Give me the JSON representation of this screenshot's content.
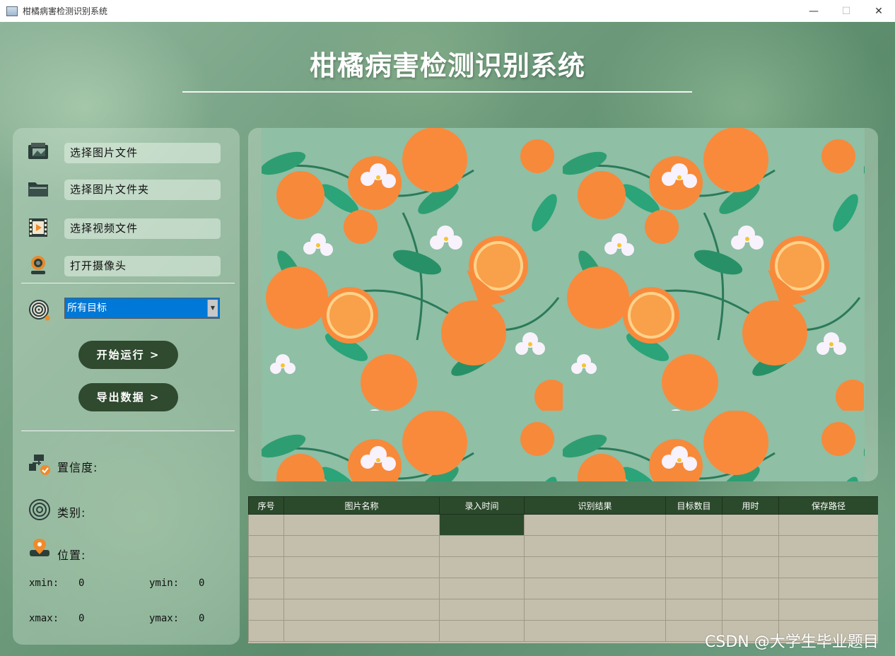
{
  "window": {
    "title": "柑橘病害检测识别系统",
    "minimize_glyph": "—",
    "maximize_glyph": "☐",
    "close_glyph": "✕"
  },
  "header": {
    "title": "柑橘病害检测识别系统"
  },
  "sidebar": {
    "sources": [
      {
        "label": "选择图片文件",
        "icon": "image-file-icon"
      },
      {
        "label": "选择图片文件夹",
        "icon": "folder-icon"
      },
      {
        "label": "选择视频文件",
        "icon": "video-file-icon"
      },
      {
        "label": "打开摄像头",
        "icon": "camera-icon"
      }
    ],
    "target_select": {
      "value": "所有目标",
      "icon": "target-icon"
    },
    "start_button": "开始运行 >",
    "export_button": "导出数据 >",
    "confidence_label": "置信度:",
    "class_label": "类别:",
    "position_label": "位置:",
    "coords": {
      "xmin_label": "xmin:",
      "xmin": "0",
      "ymin_label": "ymin:",
      "ymin": "0",
      "xmax_label": "xmax:",
      "xmax": "0",
      "ymax_label": "ymax:",
      "ymax": "0"
    }
  },
  "results_table": {
    "headers": [
      "序号",
      "图片名称",
      "录入时间",
      "识别结果",
      "目标数目",
      "用时",
      "保存路径"
    ],
    "rows": [
      [
        "",
        "",
        "",
        "",
        "",
        "",
        ""
      ],
      [
        "",
        "",
        "",
        "",
        "",
        "",
        ""
      ],
      [
        "",
        "",
        "",
        "",
        "",
        "",
        ""
      ],
      [
        "",
        "",
        "",
        "",
        "",
        "",
        ""
      ],
      [
        "",
        "",
        "",
        "",
        "",
        "",
        ""
      ],
      [
        "",
        "",
        "",
        "",
        "",
        "",
        ""
      ]
    ]
  },
  "watermark": "CSDN @大学生毕业题目",
  "colors": {
    "button_dark_green": "#2f4a2f",
    "select_blue": "#0078d7",
    "orange": "#f7893a",
    "leaf_green": "#2e9e72",
    "table_bg": "#c4bfad"
  }
}
